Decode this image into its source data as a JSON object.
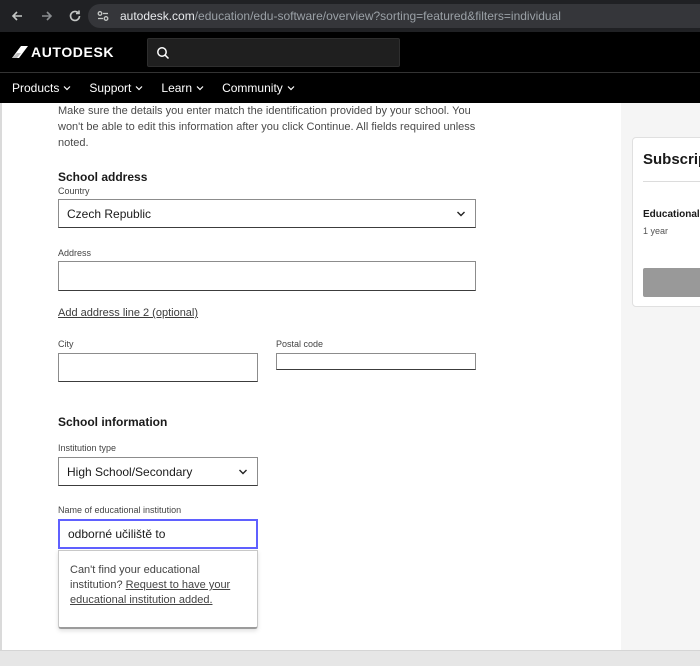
{
  "browser": {
    "url_host": "autodesk.com",
    "url_path": "/education/edu-software/overview?sorting=featured&filters=individual"
  },
  "header": {
    "logo_text": "AUTODESK"
  },
  "nav": {
    "items": [
      {
        "label": "Products"
      },
      {
        "label": "Support"
      },
      {
        "label": "Learn"
      },
      {
        "label": "Community"
      }
    ]
  },
  "form": {
    "intro": "Make sure the details you enter match the identification provided by your school. You won't be able to edit this information after you click Continue. All fields required unless noted.",
    "school_address": {
      "title": "School address",
      "country_label": "Country",
      "country_value": "Czech Republic",
      "address_label": "Address",
      "address_value": "",
      "add_line2_link": "Add address line 2 (optional)",
      "city_label": "City",
      "city_value": "",
      "postal_label": "Postal code",
      "postal_value": ""
    },
    "school_info": {
      "title": "School information",
      "institution_type_label": "Institution type",
      "institution_type_value": "High School/Secondary",
      "institution_name_label": "Name of educational institution",
      "institution_name_value": "odborné učiliště to",
      "suggest_text": "Can't find your educational institution?",
      "suggest_link": "Request to have your educational institution added."
    }
  },
  "subscription": {
    "title": "Subscrip",
    "product": "Educational",
    "term": "1 year"
  }
}
